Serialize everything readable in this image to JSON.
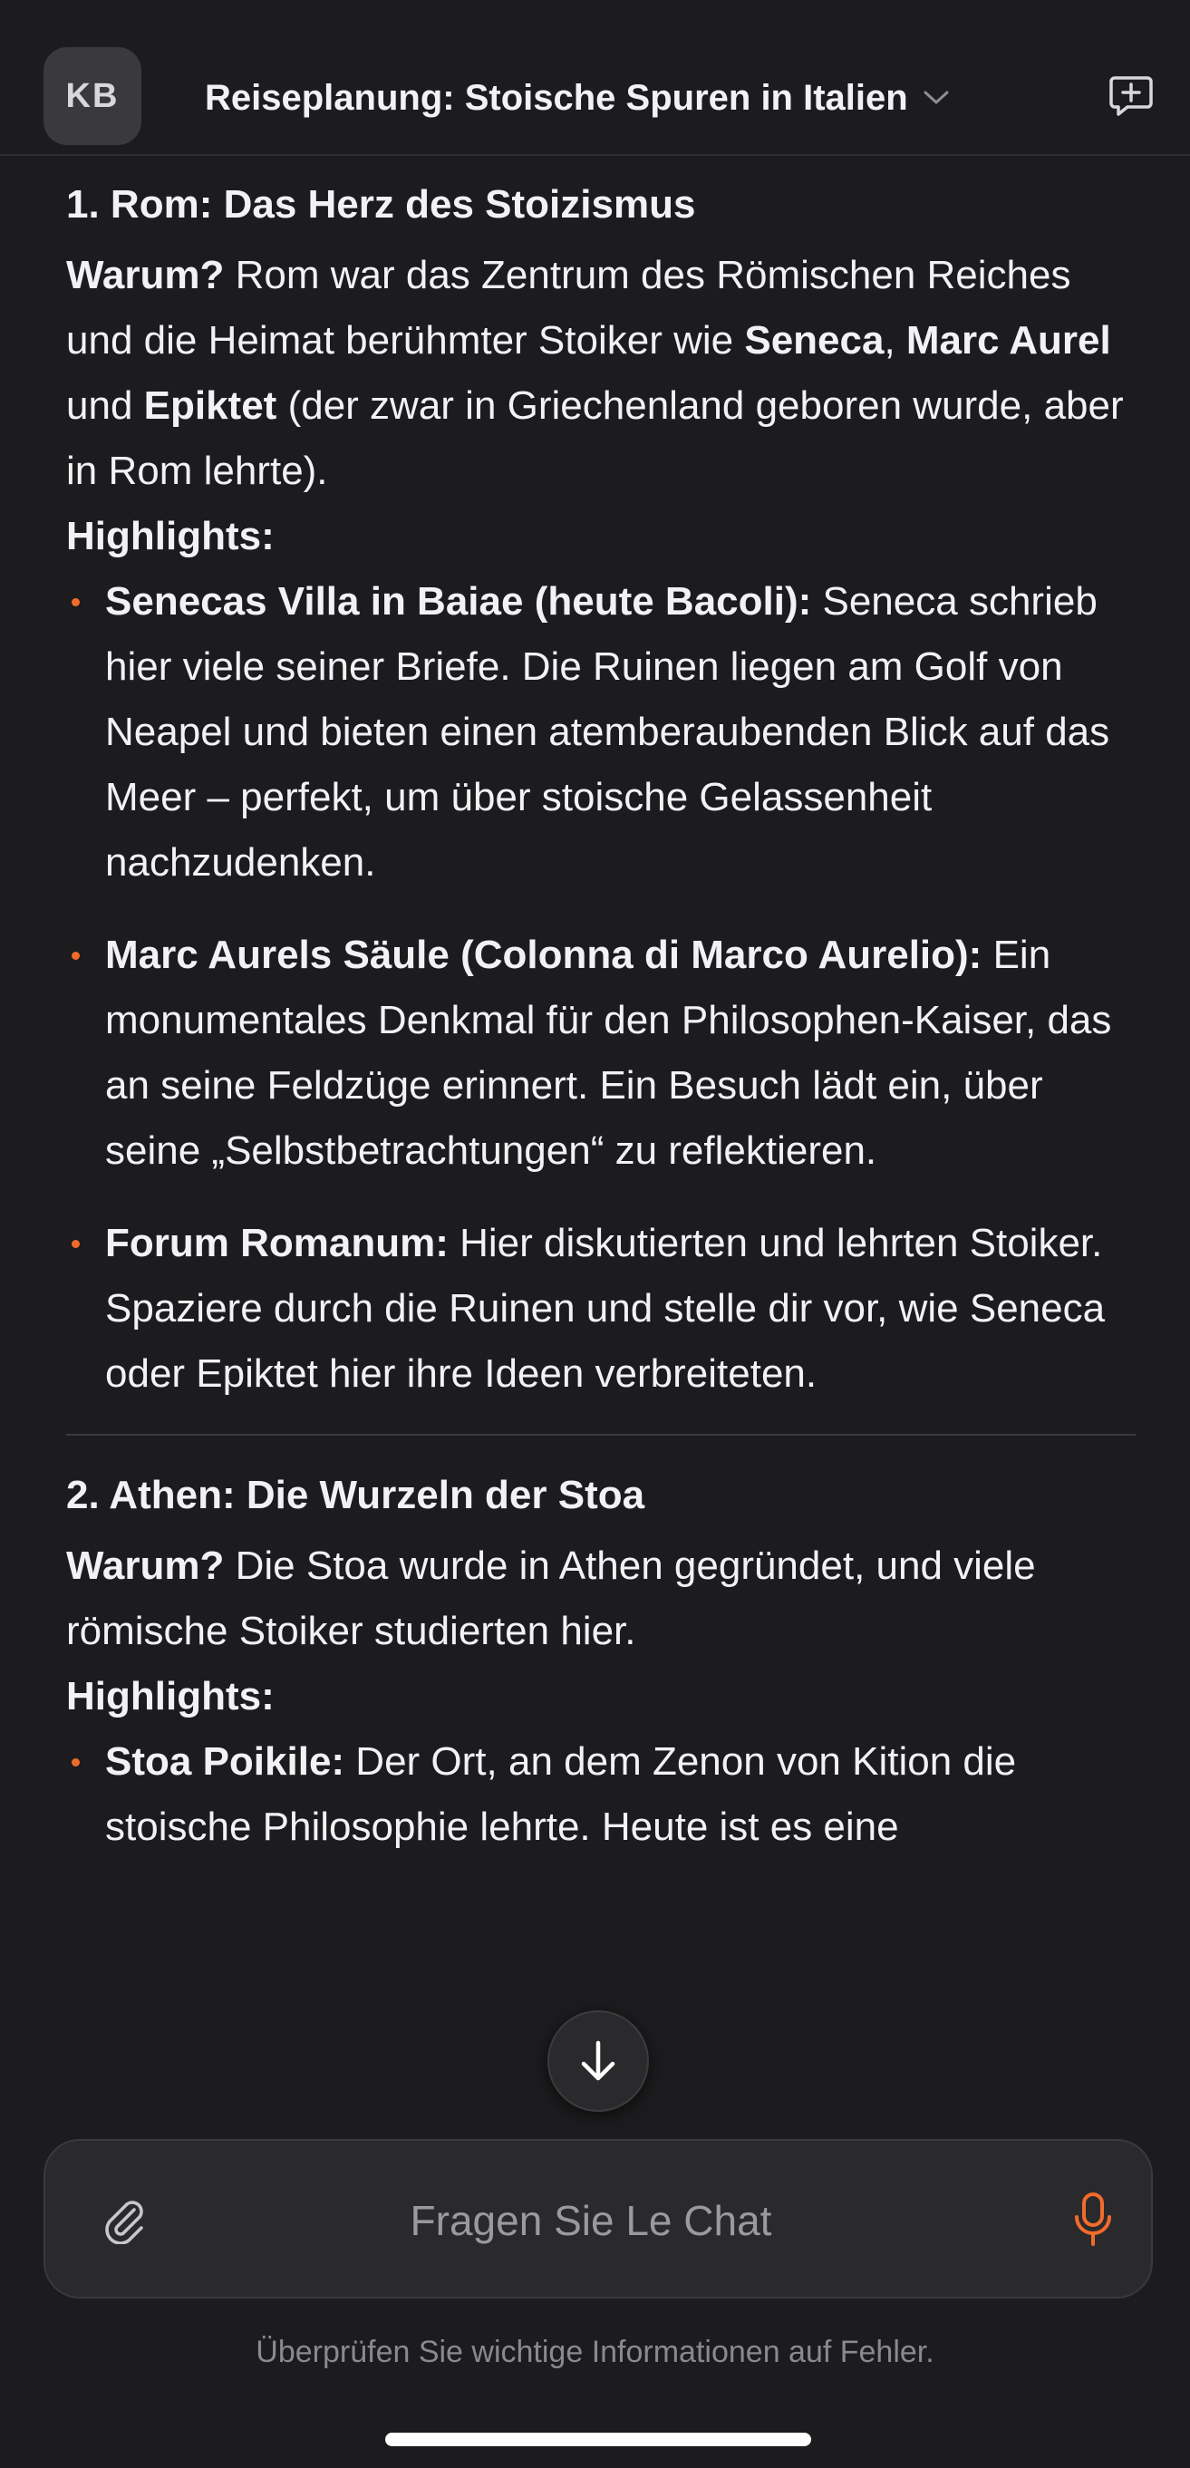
{
  "header": {
    "avatar_initials": "KB",
    "title": "Reiseplanung: Stoische Spuren in Italien"
  },
  "sections": [
    {
      "title": "1. Rom: Das Herz des Stoizismus",
      "why_label": "Warum?",
      "why_t1": " Rom war das Zentrum des Römischen Reiches und die Heimat berühmter Stoiker wie ",
      "why_b1": "Seneca",
      "why_t2": ", ",
      "why_b2": "Marc Aurel",
      "why_t3": " und ",
      "why_b3": "Epiktet",
      "why_t4": " (der zwar in Griechenland geboren wurde, aber in Rom lehrte).",
      "highlights_label": "Highlights:",
      "bullets": [
        {
          "bold": "Senecas Villa in Baiae (heute Bacoli):",
          "text": " Seneca schrieb hier viele seiner Briefe. Die Ruinen liegen am Golf von Neapel und bieten einen atemberaubenden Blick auf das Meer – perfekt, um über stoische Gelassenheit nachzudenken."
        },
        {
          "bold": "Marc Aurels Säule (Colonna di Marco Aurelio):",
          "text": " Ein monumentales Denkmal für den Philosophen-Kaiser, das an seine Feldzüge erinnert. Ein Besuch lädt ein, über seine „Selbstbetrachtungen“ zu reflektieren."
        },
        {
          "bold": "Forum Romanum:",
          "text": " Hier diskutierten und lehrten Stoiker. Spaziere durch die Ruinen und stelle dir vor, wie Seneca oder Epiktet hier ihre Ideen verbreiteten."
        }
      ]
    },
    {
      "title": "2. Athen: Die Wurzeln der Stoa",
      "why_label": "Warum?",
      "why_text": " Die Stoa wurde in Athen gegründet, und viele römische Stoiker studierten hier.",
      "highlights_label": "Highlights:",
      "bullets": [
        {
          "bold": "Stoa Poikile:",
          "text": " Der Ort, an dem Zenon von Kition die stoische Philosophie lehrte. Heute ist es eine"
        }
      ]
    }
  ],
  "composer": {
    "placeholder": "Fragen Sie Le Chat"
  },
  "disclaimer": "Überprüfen Sie wichtige Informationen auf Fehler.",
  "colors": {
    "background": "#1c1c1e",
    "accent": "#f26b2a",
    "text": "#f2f2f4"
  },
  "icons": [
    "chevron-down-icon",
    "new-chat-icon",
    "arrow-down-icon",
    "paperclip-icon",
    "microphone-icon"
  ]
}
